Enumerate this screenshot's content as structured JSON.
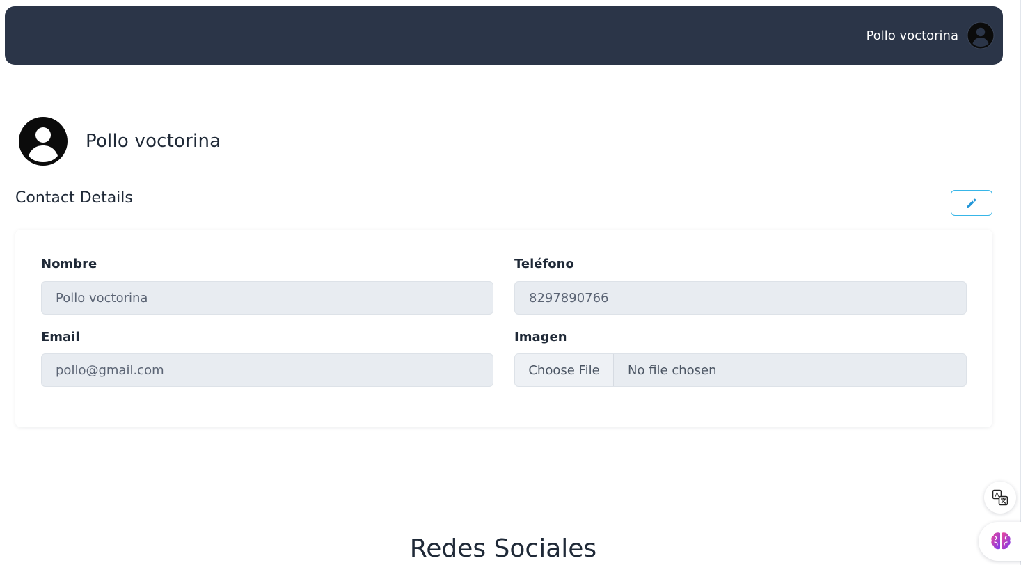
{
  "header": {
    "user_name": "Pollo voctorina",
    "avatar_icon": "user-circle-icon",
    "background": "#2b3548"
  },
  "profile": {
    "name": "Pollo voctorina",
    "avatar_icon": "user-circle-icon"
  },
  "contact_section": {
    "title": "Contact Details",
    "edit_icon": "pencil-icon",
    "accent": "#38b6e8"
  },
  "form": {
    "nombre": {
      "label": "Nombre",
      "value": "Pollo voctorina"
    },
    "telefono": {
      "label": "Teléfono",
      "value": "8297890766"
    },
    "email": {
      "label": "Email",
      "value": "pollo@gmail.com"
    },
    "imagen": {
      "label": "Imagen",
      "button": "Choose File",
      "status": "No file chosen"
    }
  },
  "social": {
    "title": "Redes Sociales"
  },
  "floating": {
    "translate_icon": "translate-icon",
    "assistant_icon": "brain-icon"
  }
}
